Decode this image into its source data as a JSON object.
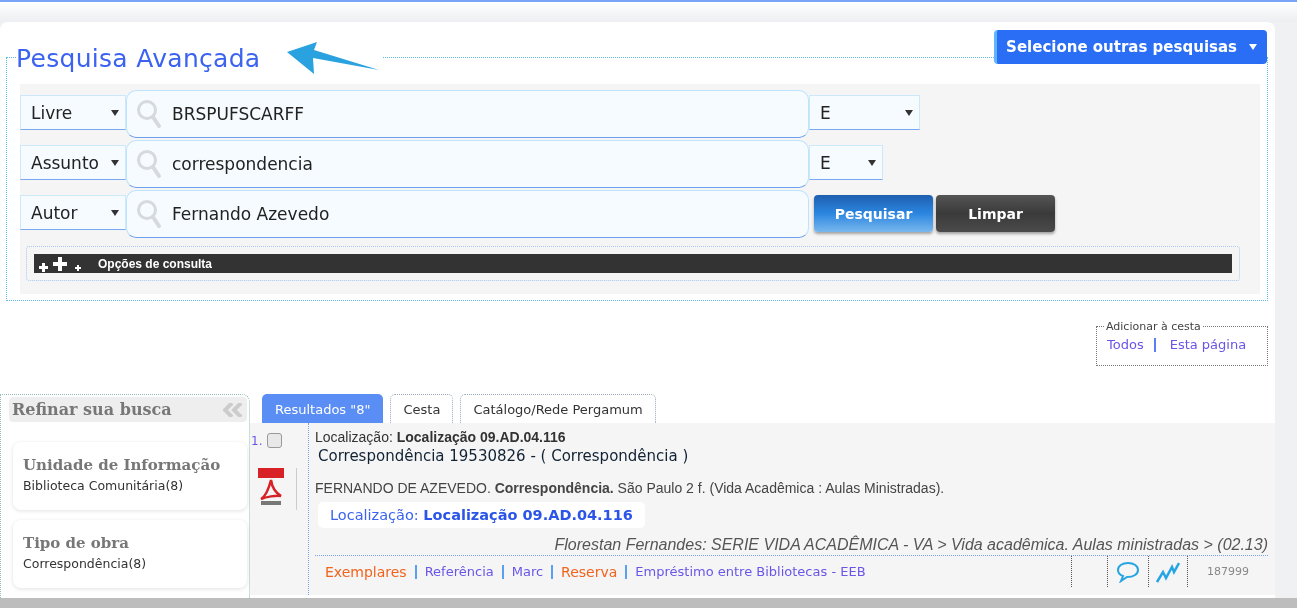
{
  "search": {
    "title": "Pesquisa Avançada",
    "other_searches": "Selecione outras pesquisas",
    "rows": [
      {
        "field": "Livre",
        "term": "BRSPUFSCARFF",
        "operator": "E"
      },
      {
        "field": "Assunto",
        "term": "correspondencia",
        "operator": "E"
      },
      {
        "field": "Autor",
        "term": "Fernando Azevedo"
      }
    ],
    "buttons": [
      {
        "label": "Pesquisar",
        "kind": "primary"
      },
      {
        "label": "Limpar",
        "kind": "secondary"
      }
    ],
    "options": "Opções de consulta"
  },
  "basket": {
    "legend": "Adicionar à cesta",
    "links": [
      "Todos",
      "Esta página"
    ]
  },
  "sidebar": {
    "title": "Refinar sua busca",
    "facets": [
      {
        "title": "Unidade de Informação",
        "items": [
          "Biblioteca Comunitária(8)"
        ]
      },
      {
        "title": "Tipo de obra",
        "items": [
          "Correspondência(8)"
        ]
      }
    ]
  },
  "tabs": [
    {
      "label": "Resultados \"8\"",
      "selected": true
    },
    {
      "label": "Cesta",
      "selected": false
    },
    {
      "label": "Catálogo/Rede Pergamum",
      "selected": false
    }
  ],
  "results": [
    {
      "number": "1.",
      "checked": false,
      "location_label": "Localização:",
      "location": "Localização 09.AD.04.116",
      "title": "Correspondência 19530826 - ( Correspondência )",
      "reference": "FERNANDO DE AZEVEDO. **Correspondência.** São Paulo 2 f. (Vida Acadêmica : Aulas Ministradas).",
      "location_box_label": "Localização:",
      "location_box": "Localização 09.AD.04.116",
      "series": "Florestan Fernandes: SERIE VIDA ACADÊMICA - VA > Vida acadêmica. Aulas ministradas > (02.13)",
      "actions": [
        {
          "label": "Exemplares",
          "kind": "highlight"
        },
        {
          "label": "Referência",
          "kind": "normal"
        },
        {
          "label": "Marc",
          "kind": "normal"
        },
        {
          "label": "Reserva",
          "kind": "highlight"
        },
        {
          "label": "Empréstimo entre Bibliotecas - EEB",
          "kind": "normal"
        }
      ],
      "record_id": "187999"
    }
  ]
}
